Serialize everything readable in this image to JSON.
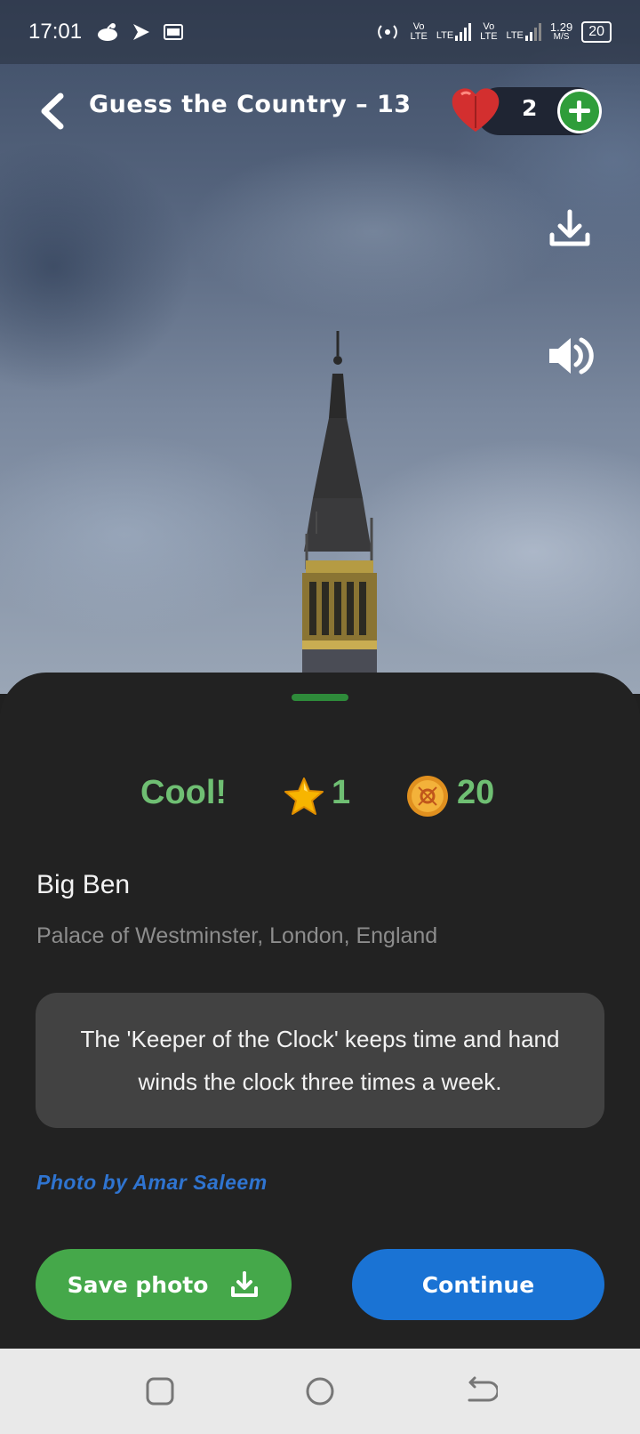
{
  "status_bar": {
    "time": "17:01",
    "left_icons": [
      "reddit-icon",
      "play-arrow-icon",
      "gs-badge-icon"
    ],
    "network_1_top": "Vo",
    "network_1_bottom": "LTE",
    "lte_1": "LTE",
    "network_2_top": "Vo",
    "network_2_bottom": "LTE",
    "lte_2": "LTE",
    "speed_value": "1.29",
    "speed_unit": "M/S",
    "battery": "20"
  },
  "header": {
    "title": "Guess the Country – 13",
    "lives": "2"
  },
  "side_actions": [
    "download-icon",
    "volume-icon"
  ],
  "result": {
    "verdict": "Cool!",
    "stars": "1",
    "coins": "20"
  },
  "place": {
    "name": "Big Ben",
    "location": "Palace of Westminster, London, England"
  },
  "fact": "The 'Keeper of the Clock' keeps time and hand winds the clock three times a week.",
  "credit": "Photo by Amar Saleem",
  "buttons": {
    "save": "Save photo",
    "continue": "Continue"
  },
  "colors": {
    "accent_green": "#45a84a",
    "score_green": "#6fbf73",
    "continue_blue": "#1a73d4",
    "credit_blue": "#2f74d0",
    "sheet_bg": "#222222"
  }
}
